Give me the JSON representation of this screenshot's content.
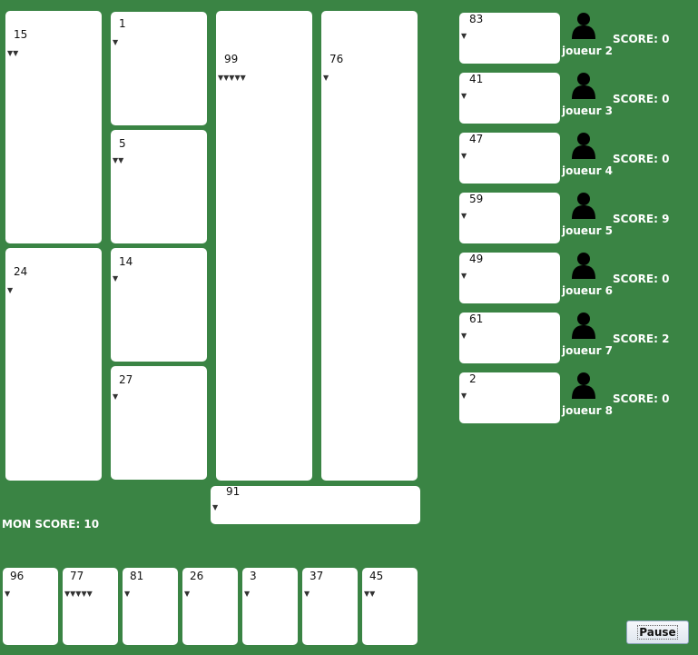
{
  "board": {
    "col1": [
      {
        "number": "15",
        "heads": "▼▼"
      },
      {
        "number": "24",
        "heads": "▼"
      }
    ],
    "col2": [
      {
        "number": "1",
        "heads": "▼"
      },
      {
        "number": "5",
        "heads": "▼▼"
      },
      {
        "number": "14",
        "heads": "▼"
      },
      {
        "number": "27",
        "heads": "▼"
      }
    ],
    "col3": {
      "number": "99",
      "heads": "▼▼▼▼▼"
    },
    "col4": {
      "number": "76",
      "heads": "▼"
    },
    "played_card": {
      "number": "91",
      "heads": "▼"
    }
  },
  "players": [
    {
      "name": "joueur 2",
      "score": "SCORE: 0",
      "card": {
        "number": "83",
        "heads": "▼"
      }
    },
    {
      "name": "joueur 3",
      "score": "SCORE: 0",
      "card": {
        "number": "41",
        "heads": "▼"
      }
    },
    {
      "name": "joueur 4",
      "score": "SCORE: 0",
      "card": {
        "number": "47",
        "heads": "▼"
      }
    },
    {
      "name": "joueur 5",
      "score": "SCORE: 9",
      "card": {
        "number": "59",
        "heads": "▼"
      }
    },
    {
      "name": "joueur 6",
      "score": "SCORE: 0",
      "card": {
        "number": "49",
        "heads": "▼"
      }
    },
    {
      "name": "joueur 7",
      "score": "SCORE: 2",
      "card": {
        "number": "61",
        "heads": "▼"
      }
    },
    {
      "name": "joueur 8",
      "score": "SCORE: 0",
      "card": {
        "number": "2",
        "heads": "▼"
      }
    }
  ],
  "my_score": "MON SCORE: 10",
  "hand": [
    {
      "number": "96",
      "heads": "▼"
    },
    {
      "number": "77",
      "heads": "▼▼▼▼▼"
    },
    {
      "number": "81",
      "heads": "▼"
    },
    {
      "number": "26",
      "heads": "▼"
    },
    {
      "number": "3",
      "heads": "▼"
    },
    {
      "number": "37",
      "heads": "▼"
    },
    {
      "number": "45",
      "heads": "▼▼"
    }
  ],
  "pause_label": "Pause",
  "icons": {
    "player": "user-silhouette-icon"
  },
  "colors": {
    "table": "#3a8444",
    "card": "#ffffff"
  }
}
